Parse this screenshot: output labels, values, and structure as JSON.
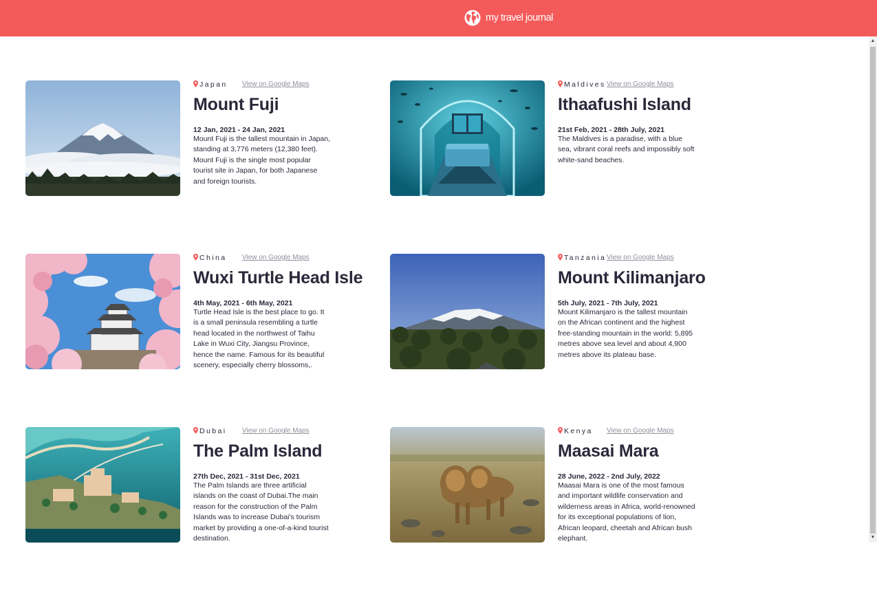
{
  "header": {
    "brand_label": "my travel journal",
    "brand_icon": "globe-icon",
    "bg_color": "#f55a5a"
  },
  "colors": {
    "text": "#2b283a",
    "link": "#918e9b",
    "pin": "#f55a5a"
  },
  "entries": [
    {
      "country": "Japan",
      "maps_label": "View on Google Maps",
      "title": "Mount Fuji",
      "dates": "12 Jan, 2021 - 24 Jan, 2021",
      "description": "Mount Fuji is the tallest mountain in Japan, standing at 3,776 meters (12,380 feet). Mount Fuji is the single most popular tourist site in Japan, for both Japanese and foreign tourists.",
      "image": "mount-fuji-photo"
    },
    {
      "country": "Maldives",
      "maps_label": "View on Google Maps",
      "title": "Ithaafushi Island",
      "dates": "21st Feb, 2021 - 28th July, 2021",
      "description": "The Maldives is a paradise, with a blue sea, vibrant coral reefs and impossibly soft white-sand beaches.",
      "image": "underwater-suite-photo"
    },
    {
      "country": "China",
      "maps_label": "View on Google Maps",
      "title": "Wuxi Turtle Head Isle",
      "dates": "4th May, 2021 - 6th May, 2021",
      "description": "Turtle Head Isle is the best place to go. It is a small peninsula resembling a turtle head located in the northwest of Taihu Lake in Wuxi City, Jiangsu Province, hence the name. Famous for its beautiful scenery, especially cherry blossoms,.",
      "image": "cherry-blossom-castle-photo"
    },
    {
      "country": "Tanzania",
      "maps_label": "View on Google Maps",
      "title": "Mount Kilimanjaro",
      "dates": "5th July, 2021 - 7th July, 2021",
      "description": "Mount Kilimanjaro is the tallest mountain on the African continent and the highest free-standing mountain in the world: 5,895 metres above sea level and about 4,900 metres above its plateau base.",
      "image": "kilimanjaro-photo"
    },
    {
      "country": "Dubai",
      "maps_label": "View on Google Maps",
      "title": "The Palm Island",
      "dates": "27th Dec, 2021 - 31st Dec, 2021",
      "description": "The Palm Islands are three artificial islands on the coast of Dubai.The main reason for the construction of the Palm Islands was to increase Dubai's tourism market by providing a one-of-a-kind tourist destination.",
      "image": "palm-island-aerial-photo"
    },
    {
      "country": "Kenya",
      "maps_label": "View on Google Maps",
      "title": "Maasai Mara",
      "dates": "28 June, 2022 - 2nd July, 2022",
      "description": "Maasai Mara is one of the most famous and important wildlife conservation and wilderness areas in Africa, world-renowned for its exceptional populations of lion, African leopard, cheetah and African bush elephant.",
      "image": "lions-photo"
    }
  ]
}
